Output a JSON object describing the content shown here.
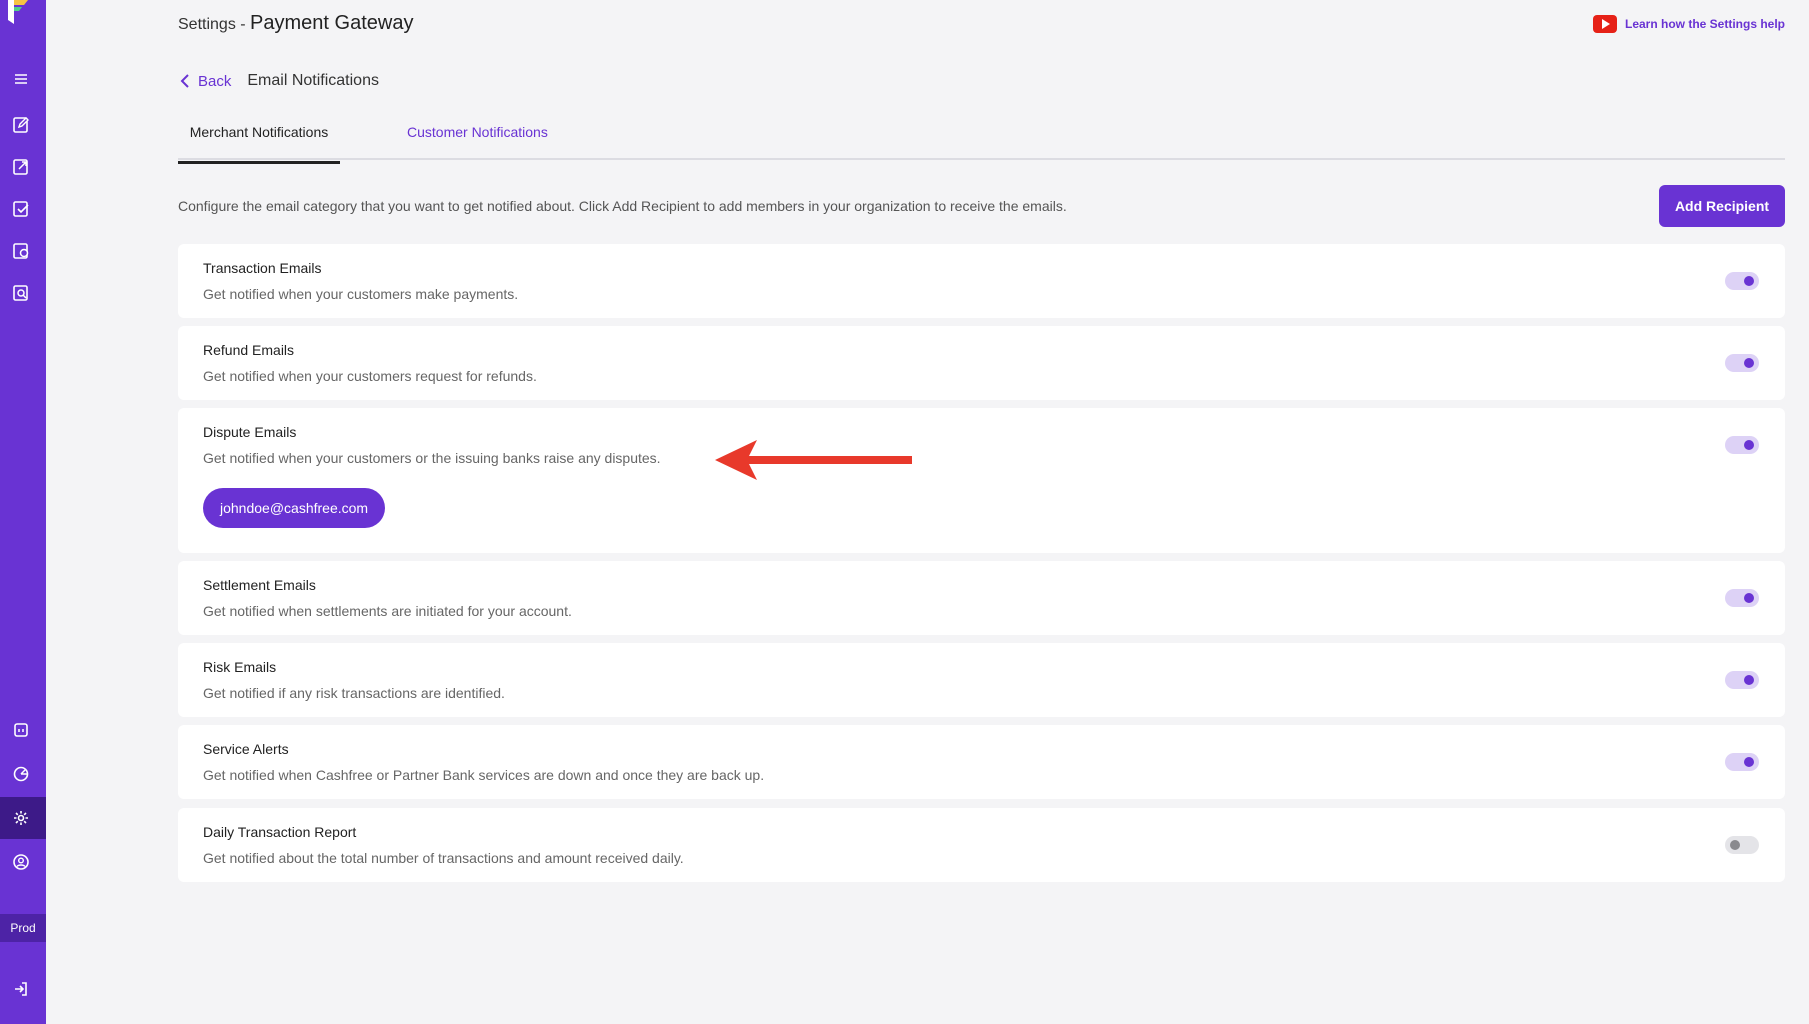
{
  "header": {
    "breadcrumb_prefix": "Settings - ",
    "title": "Payment Gateway",
    "help_link": "Learn how the Settings help"
  },
  "nav": {
    "back_label": "Back",
    "page_label": "Email Notifications"
  },
  "tabs": [
    {
      "label": "Merchant Notifications",
      "active": true
    },
    {
      "label": "Customer Notifications",
      "active": false
    }
  ],
  "description": "Configure the email category that you want to get notified about. Click Add Recipient to add members in your organization to receive the emails.",
  "add_recipient_label": "Add Recipient",
  "sidebar": {
    "env_label": "Prod",
    "icons": [
      "menu-icon",
      "edit-doc-icon",
      "export-doc-icon",
      "check-doc-icon",
      "refresh-doc-icon",
      "search-doc-icon",
      "calendar-icon",
      "chart-icon",
      "gear-icon",
      "user-icon",
      "logout-icon"
    ],
    "active_icon": "gear-icon"
  },
  "notifications": [
    {
      "title": "Transaction Emails",
      "description": "Get notified when your customers make payments.",
      "enabled": true
    },
    {
      "title": "Refund Emails",
      "description": "Get notified when your customers request for refunds.",
      "enabled": true
    },
    {
      "title": "Dispute Emails",
      "description": "Get notified when your customers or the issuing banks raise any disputes.",
      "enabled": true,
      "recipient": "johndoe@cashfree.com"
    },
    {
      "title": "Settlement Emails",
      "description": "Get notified when settlements are initiated for your account.",
      "enabled": true
    },
    {
      "title": "Risk Emails",
      "description": "Get notified if any risk transactions are identified.",
      "enabled": true
    },
    {
      "title": "Service Alerts",
      "description": "Get notified when Cashfree or Partner Bank services are down and once they are back up.",
      "enabled": true
    },
    {
      "title": "Daily Transaction Report",
      "description": "Get notified about the total number of transactions and amount received daily.",
      "enabled": false
    }
  ],
  "colors": {
    "brand": "#6933d3",
    "annotation_arrow": "#e8392b"
  }
}
